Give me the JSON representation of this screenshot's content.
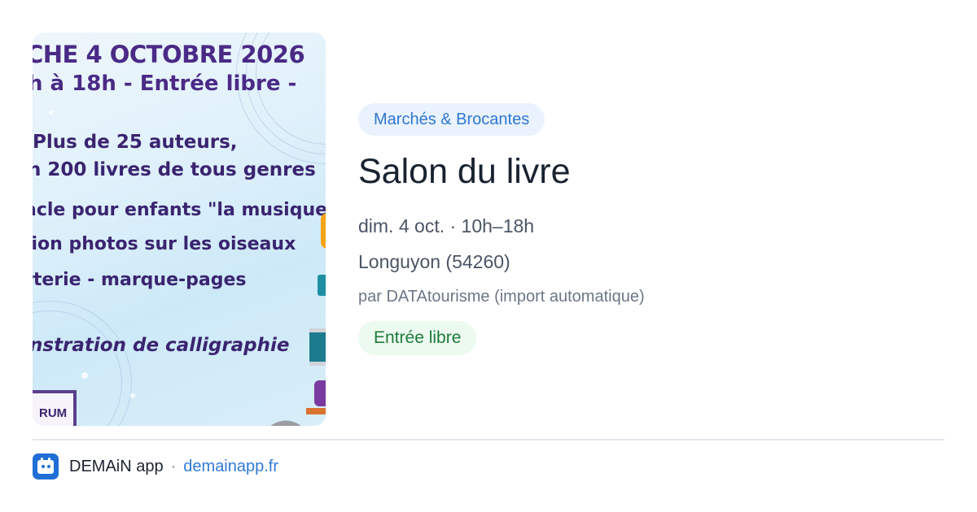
{
  "poster": {
    "lines": [
      "CHE 4 OCTOBRE 2026",
      "h à 18h  - Entrée libre -",
      "Plus de 25 auteurs,",
      "n 200 livres de tous genres",
      "acle pour enfants \"la musique\"",
      "tion photos sur les oiseaux",
      "rterie - marque-pages",
      "nstration de calligraphie",
      "RUM"
    ]
  },
  "event": {
    "category": "Marchés & Brocantes",
    "title": "Salon du livre",
    "when": "dim. 4 oct. · 10h–18h",
    "where": "Longuyon (54260)",
    "source": "par DATAtourisme (import automatique)",
    "price": "Entrée libre"
  },
  "footer": {
    "app_name": "DEMAiN app",
    "separator": "·",
    "link": "demainapp.fr"
  },
  "colors": {
    "category_badge_bg": "#eaf3fd",
    "category_badge_text": "#2f76d2",
    "price_badge_bg": "#ecfaf0",
    "price_badge_text": "#1e7a3a",
    "link": "#2f7bd6",
    "logo": "#1f6fd6"
  },
  "icons": {
    "app_logo": "calendar-face-icon"
  }
}
